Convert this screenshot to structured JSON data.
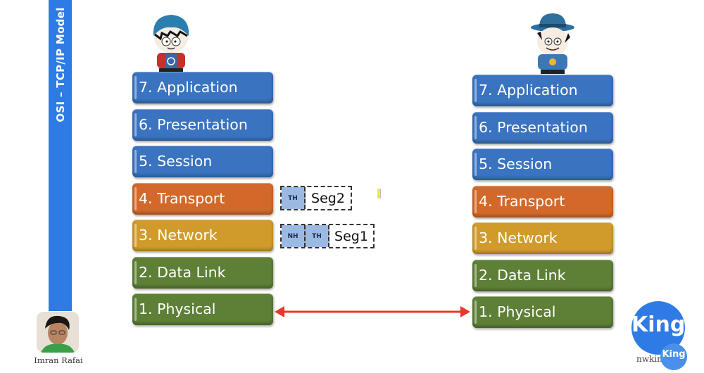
{
  "sidebar": {
    "title": "OSI – TCP/IP Model",
    "color": "#2f7be6"
  },
  "left_stack": {
    "layers": [
      {
        "label": "7. Application",
        "color": "#3a73bf"
      },
      {
        "label": "6. Presentation",
        "color": "#3a73bf"
      },
      {
        "label": "5. Session",
        "color": "#3a73bf"
      },
      {
        "label": "4. Transport",
        "color": "#d2692a"
      },
      {
        "label": "3. Network",
        "color": "#d19b2c"
      },
      {
        "label": "2. Data Link",
        "color": "#5d7f36"
      },
      {
        "label": "1. Physical",
        "color": "#5d7f36"
      }
    ]
  },
  "right_stack": {
    "layers": [
      {
        "label": "7. Application",
        "color": "#3a73bf"
      },
      {
        "label": "6. Presentation",
        "color": "#3a73bf"
      },
      {
        "label": "5. Session",
        "color": "#3a73bf"
      },
      {
        "label": "4. Transport",
        "color": "#d2692a"
      },
      {
        "label": "3. Network",
        "color": "#d19b2c"
      },
      {
        "label": "2. Data Link",
        "color": "#5d7f36"
      },
      {
        "label": "1. Physical",
        "color": "#5d7f36"
      }
    ]
  },
  "pdus": {
    "segment2": {
      "headers": [
        "TH"
      ],
      "payload": "Seg2"
    },
    "segment1": {
      "headers": [
        "NH",
        "TH"
      ],
      "payload": "Seg1"
    }
  },
  "physical_link": {
    "color": "#e8382a",
    "direction": "bidirectional"
  },
  "characters": {
    "left": "sender-character",
    "right": "receiver-character"
  },
  "presenter": {
    "name": "Imran Rafai"
  },
  "logo": {
    "text": "King",
    "small_text": "King",
    "url": "nwking.org",
    "color": "#2f7be6"
  }
}
